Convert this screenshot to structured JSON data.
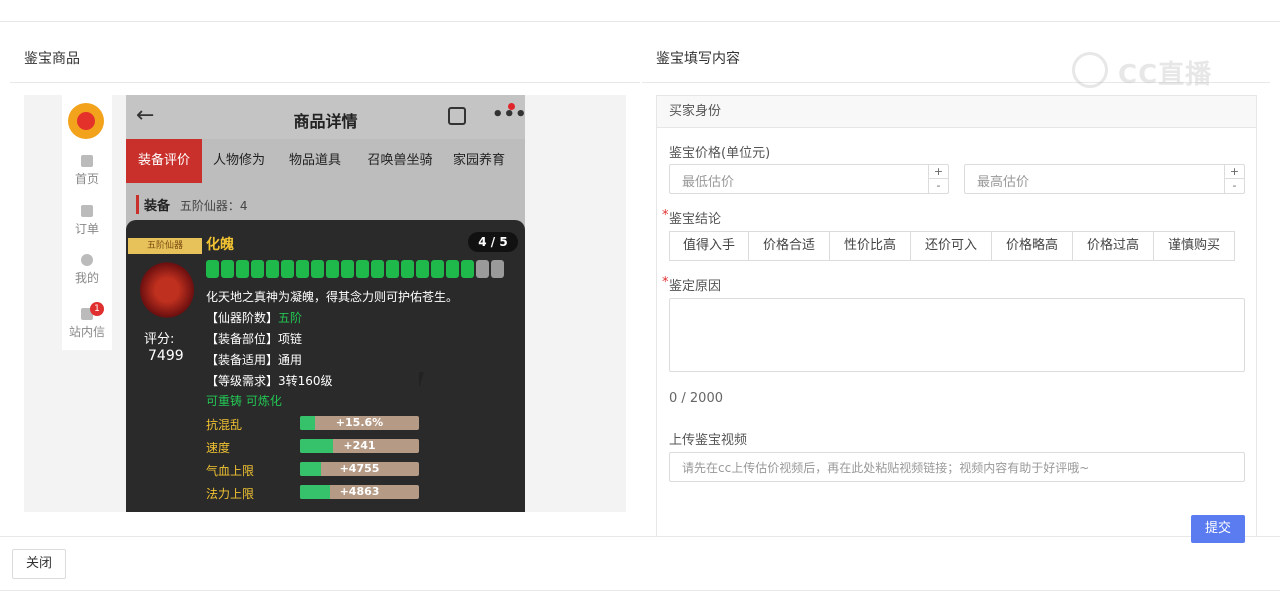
{
  "left_panel": {
    "title": "鉴宝商品"
  },
  "right_panel": {
    "title": "鉴宝填写内容"
  },
  "watermark": {
    "text": "CC直播"
  },
  "sidebar": {
    "items": [
      {
        "label": "首页",
        "icon": "home-icon"
      },
      {
        "label": "订单",
        "icon": "order-icon"
      },
      {
        "label": "我的",
        "icon": "user-icon"
      },
      {
        "label": "站内信",
        "icon": "mail-icon",
        "badge": "1"
      }
    ]
  },
  "phone": {
    "back": "←",
    "title": "商品详情",
    "more": "•••",
    "tabs": [
      "装备评价",
      "人物修为",
      "物品道具",
      "召唤兽坐骑",
      "家园养育"
    ],
    "section_label": "装备",
    "section_sub": "五阶仙器：4",
    "item": {
      "level_tag": "五阶仙器",
      "name": "化魄",
      "count": "4 / 5",
      "pips_total": 20,
      "pips_on": 18,
      "score_label": "评分:",
      "score_value": "7499",
      "desc": "化天地之真神为凝魄，得其念力则可护佑苍生。",
      "attrs": [
        {
          "key": "【仙器阶数】",
          "value": "五阶",
          "green": true
        },
        {
          "key": "【装备部位】",
          "value": "项链",
          "green": false
        },
        {
          "key": "【装备适用】",
          "value": "通用",
          "green": false
        },
        {
          "key": "【等级需求】",
          "value": "3转160级",
          "green": false
        }
      ],
      "recast": "可重铸 可炼化",
      "stats": [
        {
          "label": "抗混乱",
          "value": "+15.6%",
          "fill": 0.13
        },
        {
          "label": "速度",
          "value": "+241",
          "fill": 0.28
        },
        {
          "label": "气血上限",
          "value": "+4755",
          "fill": 0.18
        },
        {
          "label": "法力上限",
          "value": "+4863",
          "fill": 0.25
        }
      ]
    }
  },
  "form": {
    "section_header": "买家身份",
    "price_label": "鉴宝价格(单位元)",
    "min_placeholder": "最低估价",
    "max_placeholder": "最高估价",
    "conclusion_label": "鉴宝结论",
    "conclusion_options": [
      "值得入手",
      "价格合适",
      "性价比高",
      "还价可入",
      "价格略高",
      "价格过高",
      "谨慎购买"
    ],
    "reason_label": "鉴定原因",
    "counter": "0 / 2000",
    "video_label": "上传鉴宝视频",
    "video_placeholder": "请先在cc上传估价视频后，再在此处粘贴视频链接；视频内容有助于好评哦~",
    "submit": "提交",
    "stepper_plus": "+",
    "stepper_minus": "-",
    "required_mark": "*"
  },
  "footer": {
    "close": "关闭"
  }
}
